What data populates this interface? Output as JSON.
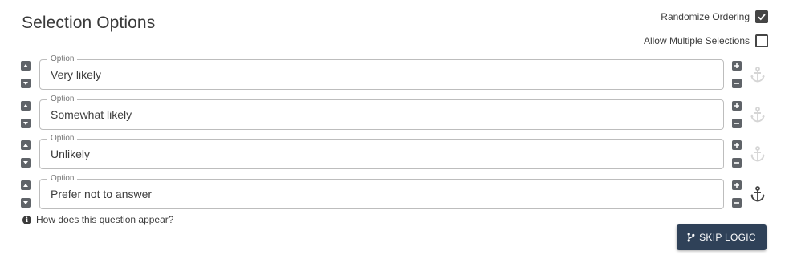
{
  "section_title": "Selection Options",
  "toggles": {
    "randomize": {
      "label": "Randomize Ordering",
      "checked": true
    },
    "multiple": {
      "label": "Allow Multiple Selections",
      "checked": false
    }
  },
  "options": [
    {
      "label": "Option",
      "value": "Very likely",
      "anchored": false
    },
    {
      "label": "Option",
      "value": "Somewhat likely",
      "anchored": false
    },
    {
      "label": "Option",
      "value": "Unlikely",
      "anchored": false
    },
    {
      "label": "Option",
      "value": "Prefer not to answer",
      "anchored": true
    }
  ],
  "help_link": "How does this question appear?",
  "skip_logic_label": "SKIP LOGIC",
  "colors": {
    "button_bg": "#2f4158",
    "anchor_active": "#454545",
    "anchor_inactive": "#d6d6d6"
  }
}
